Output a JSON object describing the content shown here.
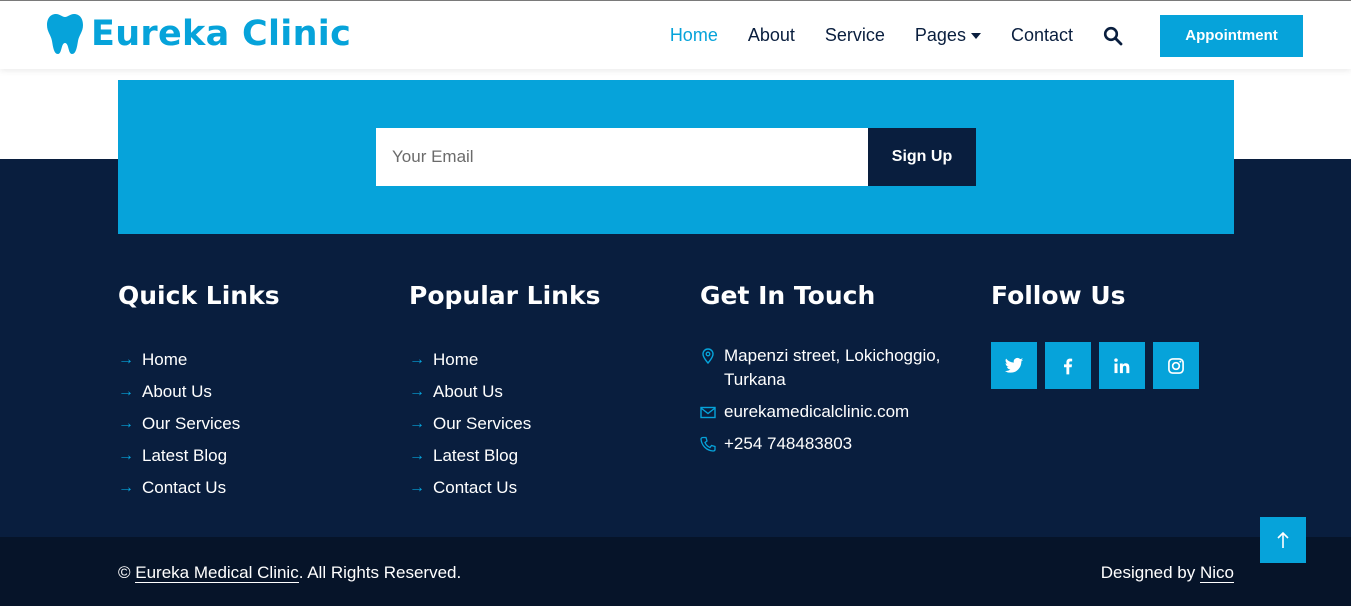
{
  "brand": {
    "name": "Eureka Clinic",
    "logo_icon": "tooth-icon",
    "accent_color": "#06a3da",
    "dark_color": "#091e3e"
  },
  "nav": {
    "items": [
      {
        "label": "Home",
        "active": true
      },
      {
        "label": "About"
      },
      {
        "label": "Service"
      },
      {
        "label": "Pages",
        "dropdown": true
      },
      {
        "label": "Contact"
      }
    ],
    "search_icon": "search-icon",
    "cta_label": "Appointment"
  },
  "newsletter": {
    "placeholder": "Your Email",
    "button_label": "Sign Up"
  },
  "footer": {
    "quick_links": {
      "title": "Quick Links",
      "items": [
        "Home",
        "About Us",
        "Our Services",
        "Latest Blog",
        "Contact Us"
      ]
    },
    "popular_links": {
      "title": "Popular Links",
      "items": [
        "Home",
        "About Us",
        "Our Services",
        "Latest Blog",
        "Contact Us"
      ]
    },
    "contact": {
      "title": "Get In Touch",
      "address": "Mapenzi street, Lokichoggio, Turkana",
      "email": "eurekamedicalclinic.com",
      "phone": "+254 748483803"
    },
    "follow": {
      "title": "Follow Us",
      "networks": [
        "twitter-icon",
        "facebook-icon",
        "linkedin-icon",
        "instagram-icon"
      ]
    }
  },
  "bottom": {
    "copyright_prefix": "© ",
    "copyright_link": "Eureka Medical Clinic",
    "copyright_suffix": ". All Rights Reserved.",
    "designed_prefix": "Designed by ",
    "designed_link": "Nico"
  },
  "arrow_glyph": "→"
}
